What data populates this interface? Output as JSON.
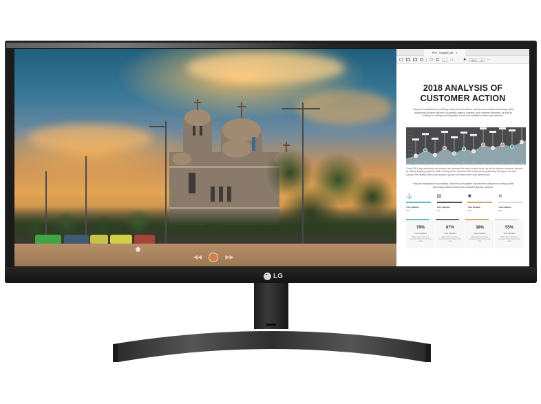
{
  "product": {
    "brand_logo_text": "LG",
    "type": "ultrawide monitor"
  },
  "screen": {
    "left_pane": {
      "content": "photo of cathedral at sunset with street, cars and trees",
      "player_controls": {
        "prev_icon": "rewind-icon",
        "play_icon": "play-button-icon",
        "next_icon": "fast-forward-icon",
        "prev_glyph": "◀◀",
        "next_glyph": "▶▶"
      }
    },
    "pdf_viewer": {
      "tab_title": "PDF_Sample.pdf",
      "tab_close": "×",
      "toolbar": {
        "icons": [
          "save-icon",
          "print-icon",
          "email-icon",
          "search-icon",
          "page-up-icon",
          "page-down-icon",
          "cursor-icon",
          "more-icon"
        ],
        "page_current": "1",
        "page_total": "/ 2",
        "zoom_value": "80%",
        "zoom_caret": "▾",
        "more": "···"
      },
      "document": {
        "title_line1": "2018 ANALYSIS OF",
        "title_line2": "CUSTOMER ACTION",
        "intro": "They are responsible for providing customers with system requirements analysis and design while developing solutions tailored to a specific agency, systems, and customer demands, as well as leading the testing and integration of new and modified solutions into systems.",
        "body": "These SW & app developers can research and evaluate the latest content trends, as well as observe consumer behavior by utilizing tracking programs. While creating whole structures with coding and programming, developers can also consider the visibility offered and quality of pictures to enhance their work performance.",
        "features_intro": "They are responsible for providing customers with system requirements analysis and design while developing solutions tailored to a specific agency, systems.",
        "features": [
          {
            "icon": "anchor-icon",
            "glyph": "⚓",
            "label": "Your Opinion",
            "value": "79%",
            "color": "#5bb8c9"
          },
          {
            "icon": "monitor-icon",
            "glyph": "▤",
            "label": "Your Opinion",
            "value": "67%",
            "color": "#555555"
          },
          {
            "icon": "gear-icon",
            "glyph": "✺",
            "label": "Your Opinion",
            "value": "38%",
            "color": "#d1a56c"
          },
          {
            "icon": "tools-icon",
            "glyph": "✕",
            "label": "Your Opinion",
            "value": "55%",
            "color": "#d9d9d9"
          }
        ],
        "stats": [
          {
            "value": "79%",
            "label": "Your Opinion",
            "desc": "Make sure to provide a summary of the content in the area",
            "color": "#5bb8c9"
          },
          {
            "value": "67%",
            "label": "Your Opinion",
            "desc": "Make sure to provide a summary of the content in the area",
            "color": "#666666"
          },
          {
            "value": "38%",
            "label": "Your Opinion",
            "desc": "Make sure to provide a summary of the content in the area",
            "color": "#d1a56c"
          },
          {
            "value": "55%",
            "label": "Your Opinion",
            "desc": "Make sure to provide a summary of the content in the area",
            "color": "#d9d9d9"
          }
        ],
        "chart": {
          "type": "area",
          "points": [
            {
              "value": 0.22,
              "color": "#e0e0e0"
            },
            {
              "value": 0.42,
              "color": "#3aa6b8"
            },
            {
              "value": 0.25,
              "color": "#e0e0e0"
            },
            {
              "value": 0.5,
              "color": "#c9957b"
            },
            {
              "value": 0.3,
              "color": "#9fd6d9"
            },
            {
              "value": 0.47,
              "color": "#3aa6b8"
            },
            {
              "value": 0.38,
              "color": "#e0e0e0"
            },
            {
              "value": 0.62,
              "color": "#c9957b"
            },
            {
              "value": 0.5,
              "color": "#e0e0e0"
            },
            {
              "value": 0.62,
              "color": "#c9957b"
            },
            {
              "value": 0.55,
              "color": "#3aa6b8"
            },
            {
              "value": 0.72,
              "color": "#e0e0e0"
            }
          ],
          "fill": "#8fa4ab",
          "background": "#4a4a4c"
        }
      }
    }
  }
}
